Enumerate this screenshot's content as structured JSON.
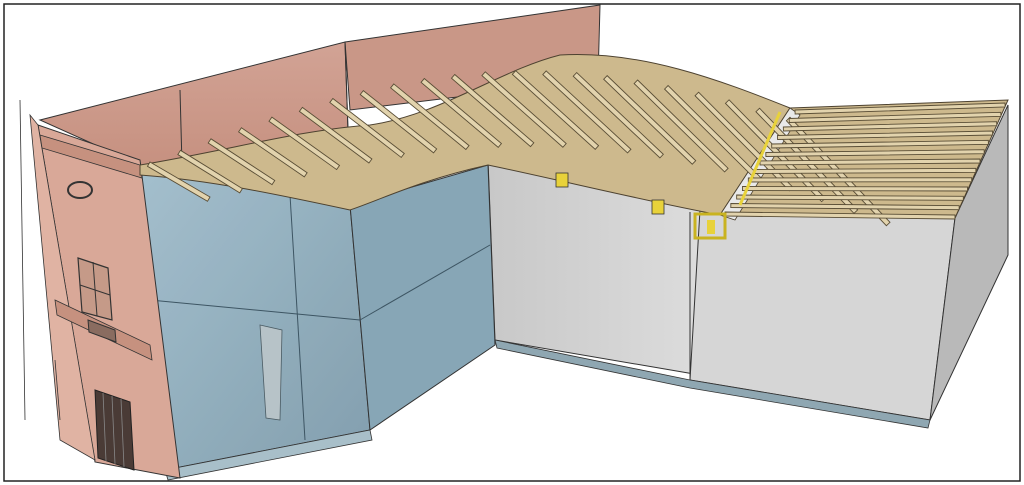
{
  "colors": {
    "background": "#ffffff",
    "frame": "#222222",
    "facade": "#d9a898",
    "facade_shade": "#c6917f",
    "glass": "#8fb0c0",
    "glass_dark": "#6f8f9f",
    "wall": "#d3d3d3",
    "wall_side": "#bdbdbd",
    "beam": "#d8c7a0",
    "beam_edge": "#5a4e36",
    "connector": "#e8d23a",
    "line": "#2a2a2a"
  },
  "icons": [
    "balcony-window-icon",
    "oval-window-icon",
    "door-grille-icon"
  ]
}
